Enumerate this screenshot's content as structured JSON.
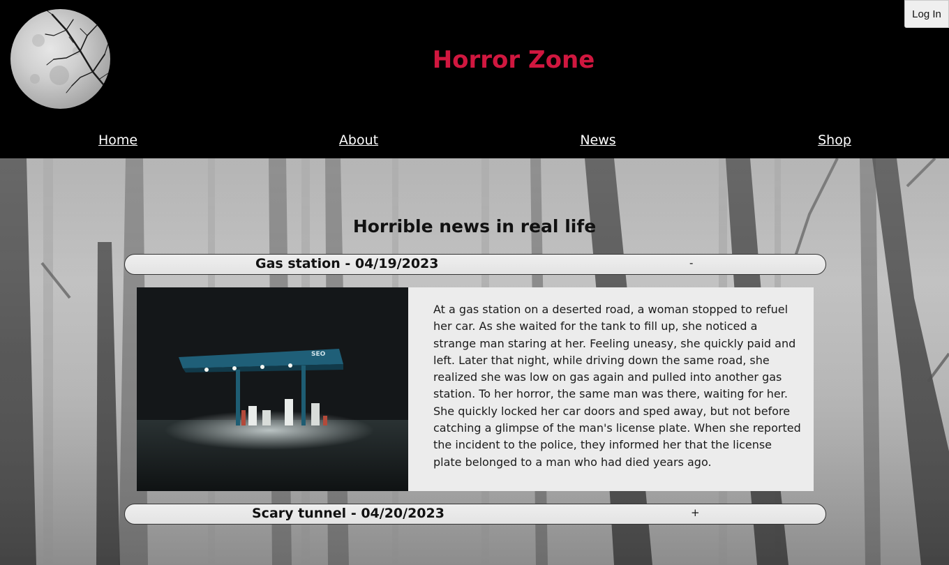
{
  "header": {
    "logo_icon": "full-moon-with-branches",
    "site_title": "Horror Zone",
    "login_label": "Log In"
  },
  "nav": {
    "items": [
      {
        "label": "Home"
      },
      {
        "label": "About"
      },
      {
        "label": "News"
      },
      {
        "label": "Shop"
      }
    ]
  },
  "main": {
    "section_title": "Horrible news in real life",
    "articles": [
      {
        "title": "Gas station - 04/19/2023",
        "toggle": "-",
        "expanded": true,
        "image": "night-gas-station-photo",
        "text": "At a gas station on a deserted road, a woman stopped to refuel her car. As she waited for the tank to fill up, she noticed a strange man staring at her. Feeling uneasy, she quickly paid and left. Later that night, while driving down the same road, she realized she was low on gas again and pulled into another gas station. To her horror, the same man was there, waiting for her. She quickly locked her car doors and sped away, but not before catching a glimpse of the man's license plate. When she reported the incident to the police, they informed her that the license plate belonged to a man who had died years ago."
      },
      {
        "title": "Scary tunnel - 04/20/2023",
        "toggle": "+",
        "expanded": false
      }
    ]
  },
  "colors": {
    "title_red": "#d0173f",
    "header_bg": "#000000",
    "panel_bg": "#ececec"
  }
}
